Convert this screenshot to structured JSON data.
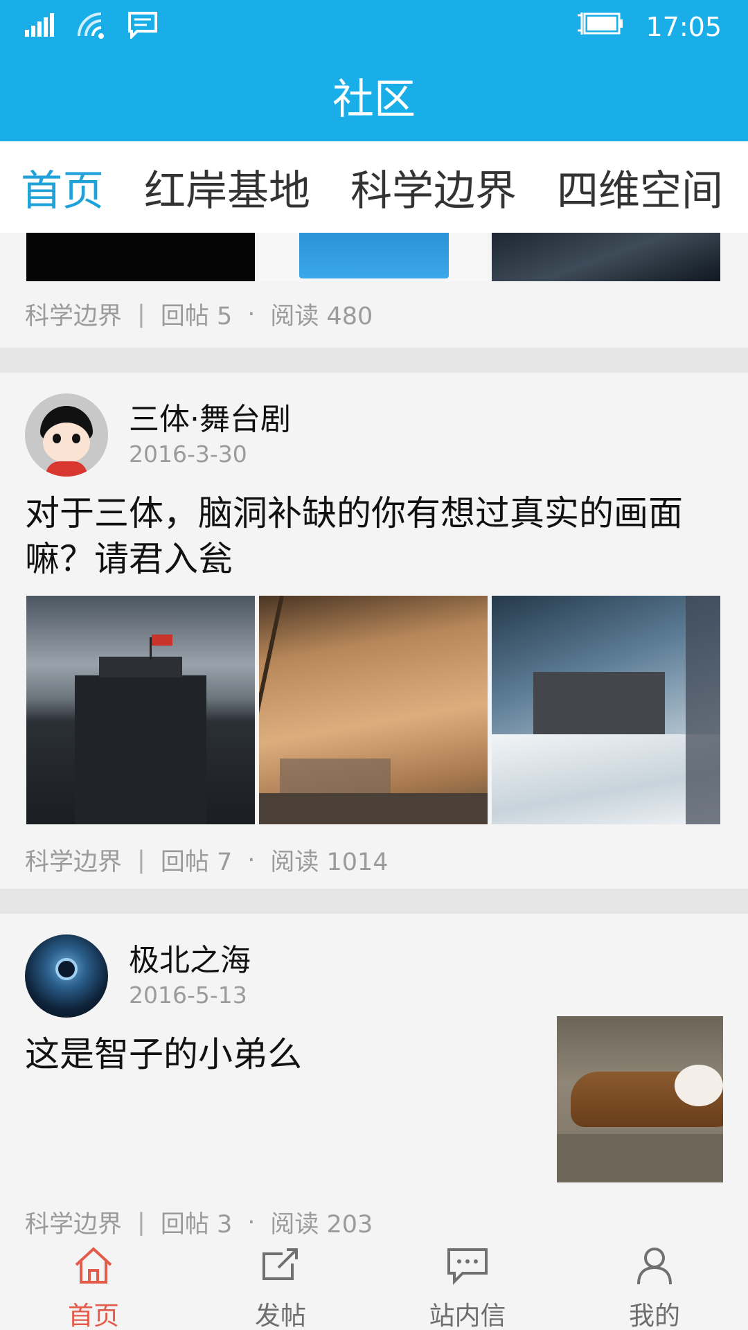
{
  "status": {
    "time": "17:05"
  },
  "header": {
    "title": "社区"
  },
  "tabs": [
    {
      "label": "首页",
      "active": true
    },
    {
      "label": "红岸基地",
      "active": false
    },
    {
      "label": "科学边界",
      "active": false
    },
    {
      "label": "四维空间",
      "active": false
    }
  ],
  "posts": [
    {
      "category": "科学边界",
      "replies": "回帖 5",
      "reads": "阅读 480"
    },
    {
      "author": "三体·舞台剧",
      "date": "2016-3-30",
      "title": "对于三体，脑洞补缺的你有想过真实的画面嘛？请君入瓮",
      "category": "科学边界",
      "replies": "回帖 7",
      "reads": "阅读 1014"
    },
    {
      "author": "极北之海",
      "date": "2016-5-13",
      "title": "这是智子的小弟么",
      "category": "科学边界",
      "replies": "回帖 3",
      "reads": "阅读 203"
    }
  ],
  "meta_sep": {
    "bar": "|",
    "dot": "·"
  },
  "nav": [
    {
      "label": "首页",
      "icon": "home-icon",
      "active": true
    },
    {
      "label": "发帖",
      "icon": "compose-icon",
      "active": false
    },
    {
      "label": "站内信",
      "icon": "message-icon",
      "active": false
    },
    {
      "label": "我的",
      "icon": "user-icon",
      "active": false
    }
  ],
  "colors": {
    "accent": "#19aee8",
    "tab_active": "#1fa2d9",
    "nav_active": "#e35b4a"
  }
}
